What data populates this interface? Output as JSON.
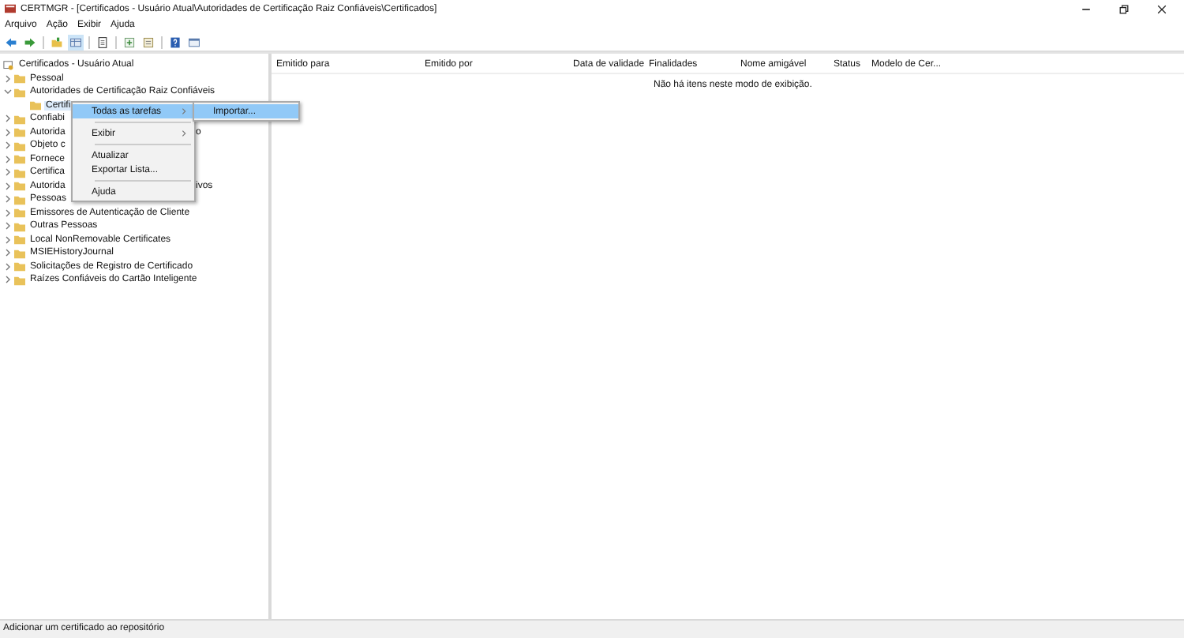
{
  "window": {
    "title": "CERTMGR - [Certificados - Usuário Atual\\Autoridades de Certificação Raiz Confiáveis\\Certificados]"
  },
  "menu_bar": [
    "Arquivo",
    "Ação",
    "Exibir",
    "Ajuda"
  ],
  "tree": {
    "label": "Certificados - Usuário Atual",
    "children": [
      {
        "label": "Pessoal",
        "expanded": false,
        "selected": false
      },
      {
        "label": "Autoridades de Certificação Raiz Confiáveis",
        "expanded": true,
        "selected": false,
        "children": [
          {
            "label": "Certifi",
            "selected": true
          }
        ]
      },
      {
        "label": "Confiabi",
        "expanded": false,
        "selected": false
      },
      {
        "label": "Autorida",
        "tail": "o",
        "expanded": false,
        "selected": false
      },
      {
        "label": "Objeto c",
        "expanded": false,
        "selected": false
      },
      {
        "label": "Fornece",
        "expanded": false,
        "selected": false
      },
      {
        "label": "Certifica",
        "expanded": false,
        "selected": false
      },
      {
        "label": "Autorida",
        "tail": "ivos",
        "expanded": false,
        "selected": false
      },
      {
        "label": "Pessoas",
        "expanded": false,
        "selected": false
      },
      {
        "label": "Emissores de Autenticação de Cliente",
        "expanded": false,
        "selected": false
      },
      {
        "label": "Outras Pessoas",
        "expanded": false,
        "selected": false
      },
      {
        "label": "Local NonRemovable Certificates",
        "expanded": false,
        "selected": false
      },
      {
        "label": "MSIEHistoryJournal",
        "expanded": false,
        "selected": false
      },
      {
        "label": "Solicitações de Registro de Certificado",
        "expanded": false,
        "selected": false
      },
      {
        "label": "Raízes Confiáveis do Cartão Inteligente",
        "expanded": false,
        "selected": false
      }
    ]
  },
  "table": {
    "columns": [
      "Emitido para",
      "Emitido por",
      "Data de validade",
      "Finalidades",
      "Nome amigável",
      "Status",
      "Modelo de Cer..."
    ],
    "empty_message": "Não há itens neste modo de exibição."
  },
  "context_menu": {
    "items": [
      {
        "kind": "item",
        "label": "Todas as tarefas",
        "submenu": true,
        "selected": true
      },
      {
        "kind": "separator"
      },
      {
        "kind": "item",
        "label": "Exibir",
        "submenu": true,
        "selected": false
      },
      {
        "kind": "separator"
      },
      {
        "kind": "item",
        "label": "Atualizar",
        "submenu": false,
        "selected": false
      },
      {
        "kind": "item",
        "label": "Exportar Lista...",
        "submenu": false,
        "selected": false
      },
      {
        "kind": "separator"
      },
      {
        "kind": "item",
        "label": "Ajuda",
        "submenu": false,
        "selected": false
      }
    ],
    "submenu": [
      {
        "label": "Importar...",
        "selected": true
      }
    ]
  },
  "status_bar": "Adicionar um certificado ao repositório"
}
